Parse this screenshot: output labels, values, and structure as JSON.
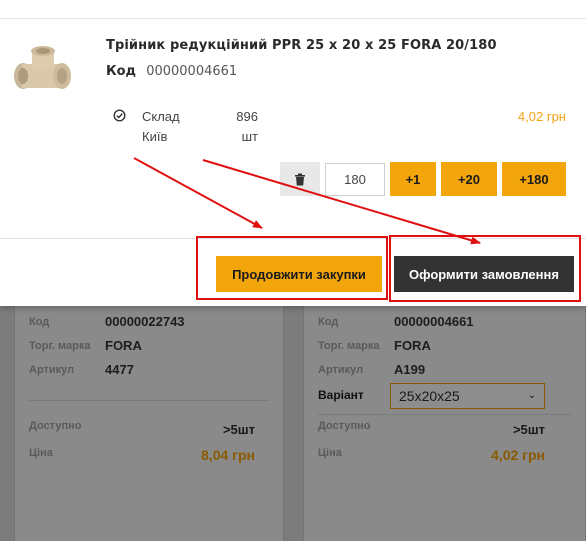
{
  "modal": {
    "product_title": "Трійник редукційний PPR 25 x 20 x 25 FORA 20/180",
    "code_label": "Код",
    "code_value": "00000004661",
    "store_name_line1": "Склад",
    "store_name_line2": "Київ",
    "stock_qty": "896",
    "stock_unit": "шт",
    "price": "4,02 грн",
    "quantity_value": "180",
    "buttons": {
      "plus1": "+1",
      "plus20": "+20",
      "plus180": "+180",
      "continue": "Продовжити закупки",
      "checkout": "Оформити замовлення"
    },
    "icons": {
      "delete": "trash-icon",
      "stock": "check-circle-icon",
      "product": "pipe-tee-fitting-image"
    }
  },
  "background_cards": [
    {
      "code_label": "Код",
      "code_value": "00000022743",
      "brand_label": "Торг. марка",
      "brand_value": "FORA",
      "article_label": "Артикул",
      "article_value": "4477",
      "available_label": "Доступно",
      "available_value": ">5шт",
      "price_label": "Ціна",
      "price_value": "8,04 грн"
    },
    {
      "code_label": "Код",
      "code_value": "00000004661",
      "brand_label": "Торг. марка",
      "brand_value": "FORA",
      "article_label": "Артикул",
      "article_value": "A199",
      "variant_label": "Варіант",
      "variant_value": "25x20x25",
      "available_label": "Доступно",
      "available_value": ">5шт",
      "price_label": "Ціна",
      "price_value": "4,02 грн"
    }
  ],
  "colors": {
    "accent": "#f3a50c",
    "price": "#f3a314",
    "checkout_bg": "#333333",
    "annotation": "#e01010",
    "overlay": "#7d7d7d"
  }
}
